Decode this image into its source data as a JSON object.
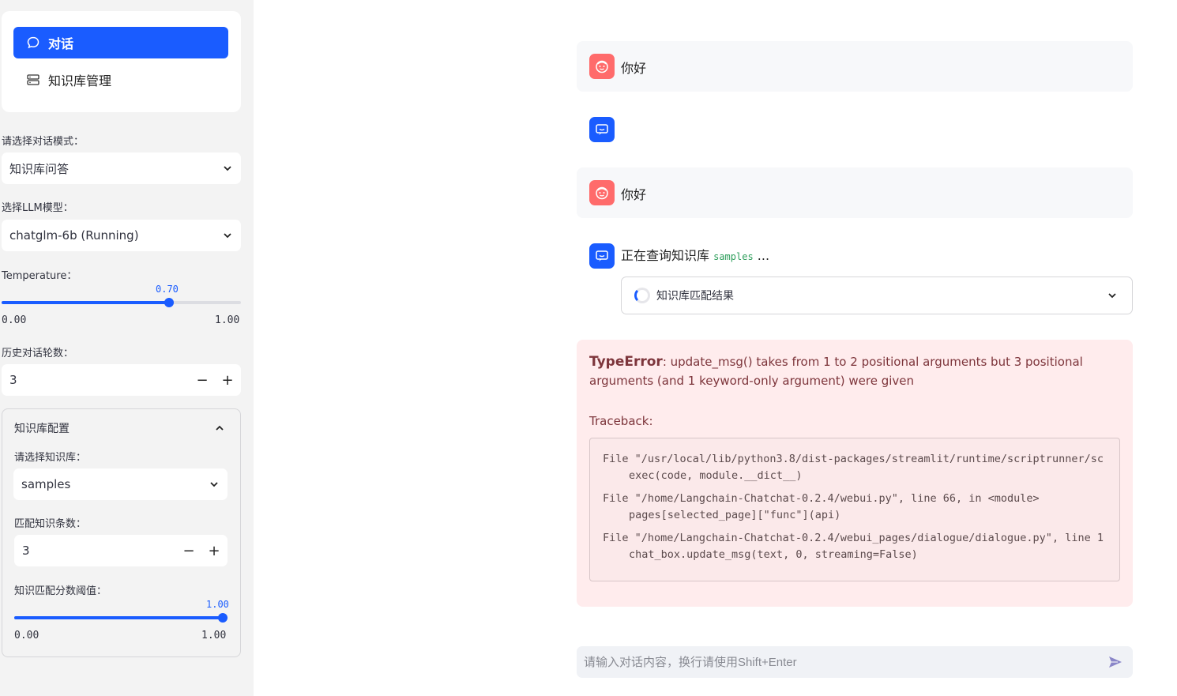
{
  "sidebar": {
    "nav": [
      {
        "label": "对话",
        "icon": "chat-bubble-icon",
        "active": true
      },
      {
        "label": "知识库管理",
        "icon": "database-icon",
        "active": false
      }
    ],
    "mode_label": "请选择对话模式：",
    "mode_value": "知识库问答",
    "llm_label": "选择LLM模型：",
    "llm_value": "chatglm-6b (Running)",
    "temp_label": "Temperature：",
    "temp_value": "0.70",
    "temp_fraction": 0.7,
    "temp_min": "0.00",
    "temp_max": "1.00",
    "history_label": "历史对话轮数：",
    "history_value": "3",
    "minus": "−",
    "plus": "+",
    "kb_config": {
      "title": "知识库配置",
      "kb_label": "请选择知识库：",
      "kb_value": "samples",
      "topk_label": "匹配知识条数：",
      "topk_value": "3",
      "score_label": "知识匹配分数阈值：",
      "score_value": "1.00",
      "score_fraction": 1.0,
      "score_min": "0.00",
      "score_max": "1.00"
    }
  },
  "chat": {
    "messages": [
      {
        "role": "user",
        "text": "你好"
      },
      {
        "role": "assistant",
        "text": ""
      },
      {
        "role": "user",
        "text": "你好"
      },
      {
        "role": "assistant",
        "text_prefix": "正在查询知识库",
        "code": "samples",
        "text_suffix": " ..."
      }
    ],
    "kb_result_label": "知识库匹配结果",
    "error": {
      "type": "TypeError",
      "message": ": update_msg() takes from 1 to 2 positional arguments but 3 positional arguments (and 1 keyword-only argument) were given",
      "traceback_label": "Traceback:",
      "lines": [
        "File \"/usr/local/lib/python3.8/dist-packages/streamlit/runtime/scriptrunner/sc",
        "exec(code, module.__dict__)",
        "File \"/home/Langchain-Chatchat-0.2.4/webui.py\", line 66, in <module>",
        "pages[selected_page][\"func\"](api)",
        "File \"/home/Langchain-Chatchat-0.2.4/webui_pages/dialogue/dialogue.py\", line 1",
        "chat_box.update_msg(text, 0, streaming=False)"
      ]
    },
    "input_placeholder": "请输入对话内容，换行请使用Shift+Enter"
  },
  "colors": {
    "accent": "#1a5cff",
    "user_avatar": "#ff6b6b",
    "error_bg": "#ffeced"
  }
}
